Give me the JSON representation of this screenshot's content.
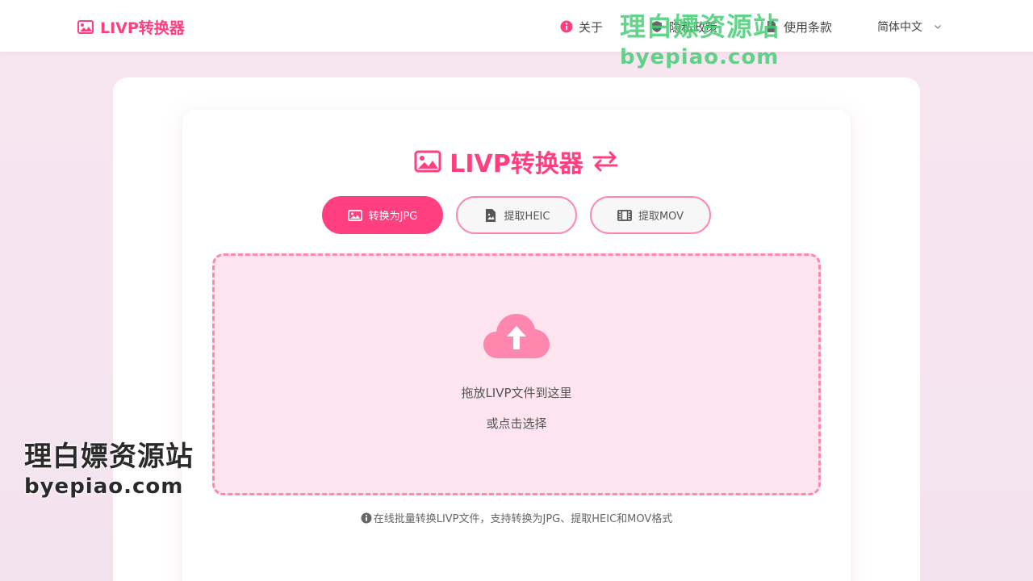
{
  "header": {
    "brand": "LIVP转换器",
    "nav": {
      "about": "关于",
      "privacy": "隐私政策",
      "terms": "使用条款"
    },
    "language": "简体中文"
  },
  "watermark": {
    "chinese": "理白嫖资源站",
    "url": "byepiao.com"
  },
  "main": {
    "title": "LIVP转换器",
    "tabs": [
      {
        "label": "转换为JPG",
        "active": true
      },
      {
        "label": "提取HEIC",
        "active": false
      },
      {
        "label": "提取MOV",
        "active": false
      }
    ],
    "dropzone": {
      "primary": "拖放LIVP文件到这里",
      "secondary": "或点击选择"
    },
    "info": "在线批量转换LIVP文件，支持转换为JPG、提取HEIC和MOV格式"
  },
  "colors": {
    "accent": "#ff3f7f",
    "accent_light": "#ff86ac",
    "drop_bg": "#fde4ee",
    "watermark_green": "#48cd76"
  }
}
